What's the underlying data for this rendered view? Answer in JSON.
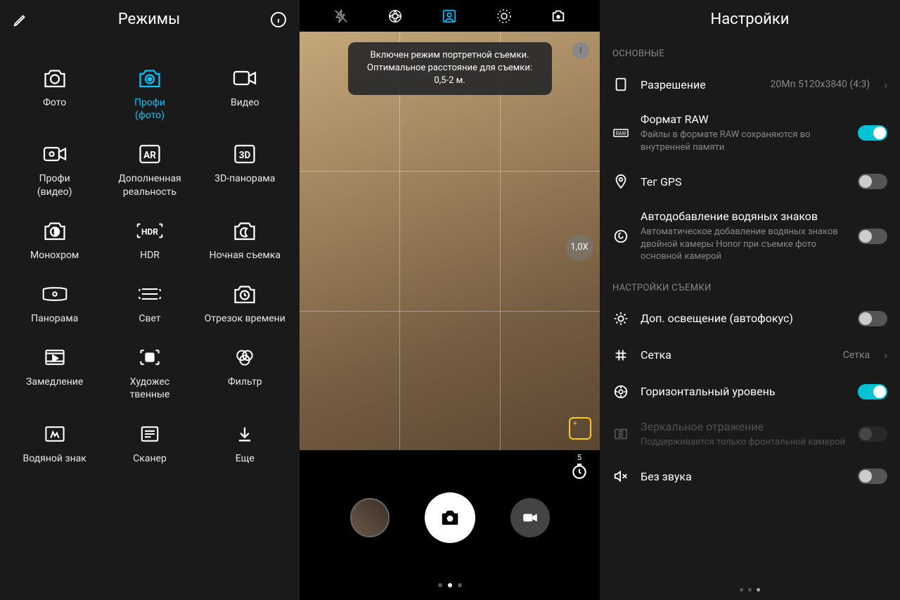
{
  "modes": {
    "title": "Режимы",
    "items": [
      {
        "id": "photo",
        "label": "Фото"
      },
      {
        "id": "pro-photo",
        "label": "Профи\n(фото)",
        "active": true
      },
      {
        "id": "video",
        "label": "Видео"
      },
      {
        "id": "pro-video",
        "label": "Профи\n(видео)"
      },
      {
        "id": "ar",
        "label": "Дополненная реальность"
      },
      {
        "id": "3d-panorama",
        "label": "3D-панорама"
      },
      {
        "id": "monochrome",
        "label": "Монохром"
      },
      {
        "id": "hdr",
        "label": "HDR"
      },
      {
        "id": "night",
        "label": "Ночная съемка"
      },
      {
        "id": "panorama",
        "label": "Панорама"
      },
      {
        "id": "light",
        "label": "Свет"
      },
      {
        "id": "timelapse",
        "label": "Отрезок времени"
      },
      {
        "id": "slowmo",
        "label": "Замедление"
      },
      {
        "id": "artistic",
        "label": "Художес\nтвенные"
      },
      {
        "id": "filter",
        "label": "Фильтр"
      },
      {
        "id": "watermark",
        "label": "Водяной знак"
      },
      {
        "id": "scanner",
        "label": "Сканер"
      },
      {
        "id": "more",
        "label": "Еще"
      }
    ]
  },
  "camera": {
    "toast": "Включен режим портретной съемки.\nОптимальное расстояние для съемки:\n0,5-2 м.",
    "zoom": "1,0X",
    "timer": "5"
  },
  "settings": {
    "title": "Настройки",
    "section1": "ОСНОВНЫЕ",
    "section2": "НАСТРОЙКИ СЪЕМКИ",
    "resolution": {
      "label": "Разрешение",
      "value": "20Мп 5120x3840 (4:3)"
    },
    "raw": {
      "label": "Формат RAW",
      "sub": "Файлы в формате RAW сохраняются во внутренней памяти"
    },
    "gps": {
      "label": "Тег GPS"
    },
    "watermark": {
      "label": "Автодобавление водяных знаков",
      "sub": "Автоматическое добавление водяных знаков двойной камеры Honor при съемке фото основной камерой"
    },
    "autofocus": {
      "label": "Доп. освещение (автофокус)"
    },
    "grid": {
      "label": "Сетка",
      "value": "Сетка"
    },
    "level": {
      "label": "Горизонтальный уровень"
    },
    "mirror": {
      "label": "Зеркальное отражение",
      "sub": "Поддерживается только фронтальной камерой"
    },
    "silent": {
      "label": "Без звука"
    }
  }
}
